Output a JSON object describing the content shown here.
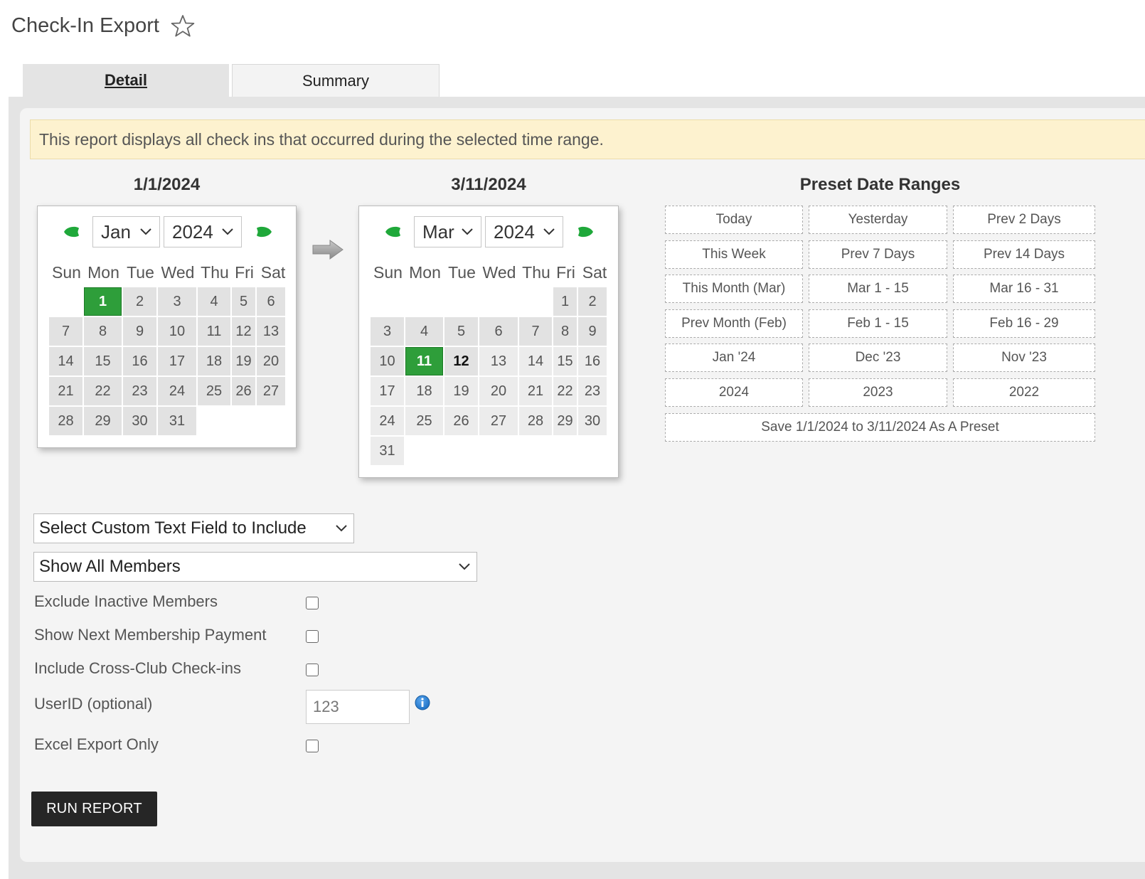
{
  "page": {
    "title": "Check-In Export",
    "favorite_icon": "star-outline-icon"
  },
  "tabs": [
    {
      "label": "Detail",
      "active": true
    },
    {
      "label": "Summary",
      "active": false
    }
  ],
  "notice": "This report displays all check ins that occurred during the selected time range.",
  "weekdays": [
    "Sun",
    "Mon",
    "Tue",
    "Wed",
    "Thu",
    "Fri",
    "Sat"
  ],
  "start_calendar": {
    "heading": "1/1/2024",
    "month": "Jan",
    "year": "2024",
    "first_weekday": 1,
    "days_in_month": 31,
    "selected_day": 1
  },
  "end_calendar": {
    "heading": "3/11/2024",
    "month": "Mar",
    "year": "2024",
    "first_weekday": 5,
    "days_in_month": 31,
    "selected_day": 11,
    "current_day": 12
  },
  "presets": {
    "title": "Preset Date Ranges",
    "rows": [
      [
        "Today",
        "Yesterday",
        "Prev 2 Days"
      ],
      [
        "This Week",
        "Prev 7 Days",
        "Prev 14 Days"
      ],
      [
        "This Month (Mar)",
        "Mar 1 - 15",
        "Mar 16 - 31"
      ],
      [
        "Prev Month (Feb)",
        "Feb 1 - 15",
        "Feb 16 - 29"
      ],
      [
        "Jan '24",
        "Dec '23",
        "Nov '23"
      ],
      [
        "2024",
        "2023",
        "2022"
      ]
    ],
    "save_label": "Save 1/1/2024 to 3/11/2024 As A Preset"
  },
  "filters": {
    "custom_field": "Select Custom Text Field to Include",
    "members": "Show All Members"
  },
  "options": {
    "exclude_inactive": {
      "label": "Exclude Inactive Members",
      "checked": false
    },
    "next_payment": {
      "label": "Show Next Membership Payment",
      "checked": false
    },
    "cross_club": {
      "label": "Include Cross-Club Check-ins",
      "checked": false
    },
    "userid": {
      "label": "UserID (optional)",
      "placeholder": "123"
    },
    "excel_only": {
      "label": "Excel Export Only",
      "checked": false
    }
  },
  "run_button": "RUN REPORT",
  "colors": {
    "selected_day": "#2e9e3a",
    "notice_bg": "#fdf2cf",
    "nav_arrow": "#1fa83a",
    "button": "#262626",
    "info": "#1c6fc4"
  }
}
